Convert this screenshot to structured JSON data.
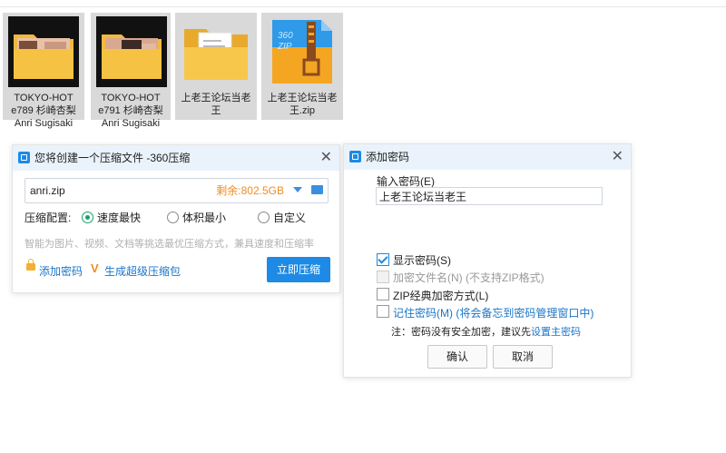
{
  "files": [
    {
      "line1": "TOKYO-HOT",
      "line2": "e789 杉崎杏梨",
      "line3": "Anri Sugisaki"
    },
    {
      "line1": "TOKYO-HOT",
      "line2": "e791 杉崎杏梨",
      "line3": "Anri Sugisaki"
    },
    {
      "line1": "上老王论坛当老",
      "line2": "王",
      "line3": ""
    },
    {
      "line1": "上老王论坛当老",
      "line2": "王.zip",
      "line3": ""
    }
  ],
  "zip_icon_text": "360\nZIP",
  "compress_dialog": {
    "title": "您将创建一个压缩文件 -360压缩",
    "filename": "anri.zip",
    "remaining": "剩余:802.5GB",
    "config_label": "压缩配置:",
    "options": [
      "速度最快",
      "体积最小",
      "自定义"
    ],
    "selected_option": "速度最快",
    "hint": "智能为图片、视频、文档等挑选最优压缩方式，兼具速度和压缩率",
    "add_password": "添加密码",
    "self_extract": "生成超级压缩包",
    "compress_now": "立即压缩"
  },
  "password_dialog": {
    "title": "添加密码",
    "input_label": "输入密码(E)",
    "password_value": "上老王论坛当老王",
    "show_password": "显示密码(S)",
    "encrypt_names": "加密文件名(N) (不支持ZIP格式)",
    "zip_classic": "ZIP经典加密方式(L)",
    "remember": "记住密码(M) (将会备忘到密码管理窗口中)",
    "note_prefix": "注：密码没有安全加密，建议先",
    "note_link": "设置主密码",
    "ok": "确认",
    "cancel": "取消"
  },
  "colors": {
    "accent": "#1d8ae5",
    "orange": "#f08c1e",
    "green": "#19a06a"
  }
}
